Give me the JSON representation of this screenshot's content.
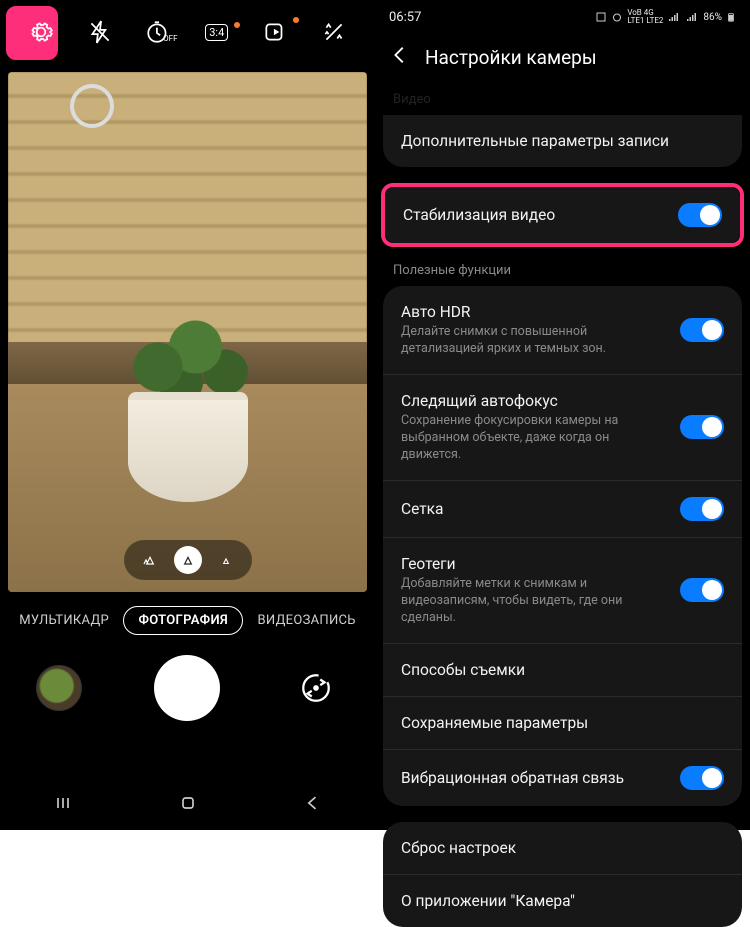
{
  "left": {
    "topbar": {
      "timer_off": "OFF",
      "ratio": "3:4"
    },
    "zoom": {
      "wide": "⟐",
      "std": "⟐",
      "tele": "⟐"
    },
    "modes": {
      "multiframe": "МУЛЬТИКАДР",
      "photo": "ФОТОГРАФИЯ",
      "video": "ВИДЕОЗАПИСЬ"
    }
  },
  "right": {
    "status": {
      "time": "06:57",
      "battery": "86%"
    },
    "header": "Настройки камеры",
    "video_section": "Видео",
    "rows": {
      "advanced_recording": "Дополнительные параметры записи",
      "stabilization": "Стабилизация видео"
    },
    "useful_section": "Полезные функции",
    "auto_hdr": {
      "label": "Авто HDR",
      "sub": "Делайте снимки с повышенной детализацией ярких и темных зон."
    },
    "tracking_af": {
      "label": "Следящий автофокус",
      "sub": "Сохранение фокусировки камеры на выбранном объекте, даже когда он движется."
    },
    "grid": {
      "label": "Сетка"
    },
    "geotags": {
      "label": "Геотеги",
      "sub": "Добавляйте метки к снимкам и видеозаписям, чтобы видеть, где они сделаны."
    },
    "shooting_methods": "Способы съемки",
    "saved_params": "Сохраняемые параметры",
    "haptic": "Вибрационная обратная связь",
    "reset": "Сброс настроек",
    "about": "О приложении \"Камера\""
  }
}
